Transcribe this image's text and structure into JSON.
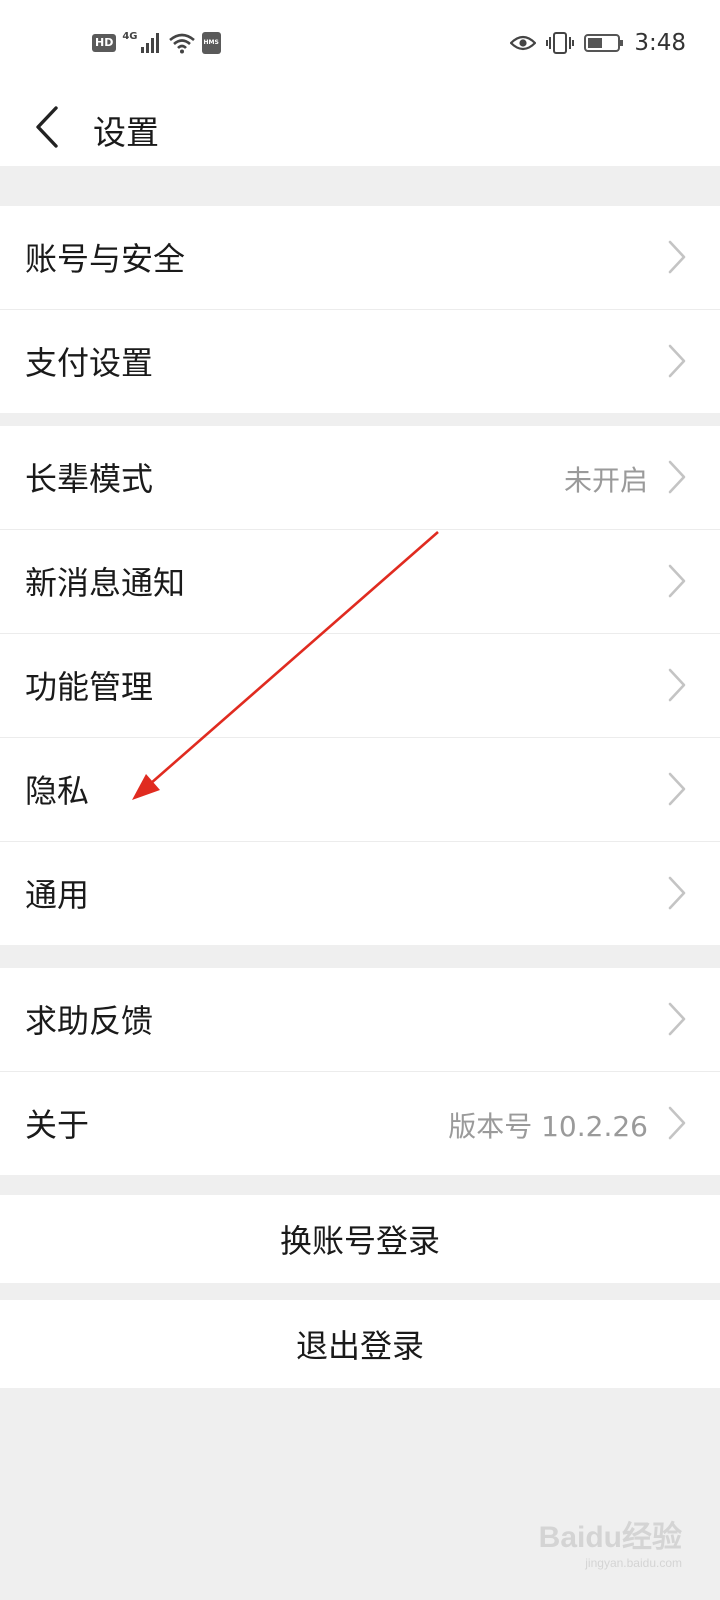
{
  "status_bar": {
    "hd_badge": "HD",
    "network": "4G",
    "hms_badge": "HMS",
    "time": "3:48"
  },
  "header": {
    "back_icon": "chevron-left-icon",
    "title": "设置"
  },
  "groups": [
    {
      "items": [
        {
          "label": "账号与安全",
          "value": ""
        },
        {
          "label": "支付设置",
          "value": ""
        }
      ]
    },
    {
      "items": [
        {
          "label": "长辈模式",
          "value": "未开启"
        },
        {
          "label": "新消息通知",
          "value": ""
        },
        {
          "label": "功能管理",
          "value": ""
        },
        {
          "label": "隐私",
          "value": ""
        },
        {
          "label": "通用",
          "value": ""
        }
      ]
    },
    {
      "items": [
        {
          "label": "求助反馈",
          "value": ""
        },
        {
          "label": "关于",
          "value": "版本号 10.2.26"
        }
      ]
    }
  ],
  "actions": {
    "switch_account": "换账号登录",
    "logout": "退出登录"
  },
  "annotation": {
    "arrow_color": "#e02b20",
    "points_to": "隐私"
  },
  "watermark": {
    "brand": "Baidu经验",
    "url": "jingyan.baidu.com"
  },
  "colors": {
    "background": "#efefef",
    "surface": "#ffffff",
    "text": "#1a1a1a",
    "secondary_text": "#9a9a9a",
    "chevron": "#c4c4c4"
  }
}
